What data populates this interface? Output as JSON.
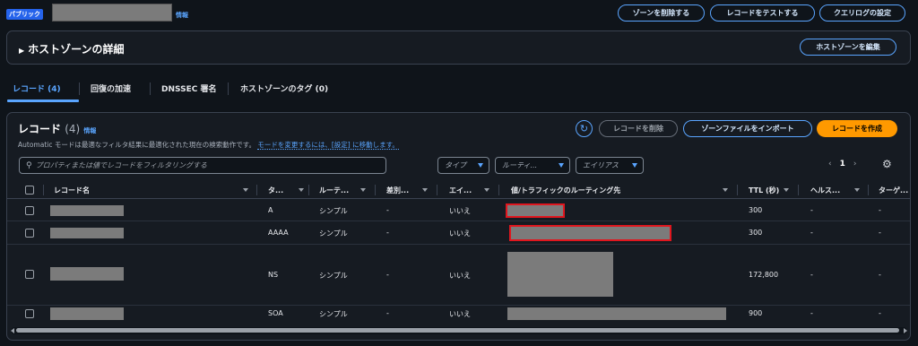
{
  "header": {
    "badge": "パブリック",
    "info": "情報",
    "buttons": {
      "delete_zone": "ゾーンを削除する",
      "test_record": "レコードをテストする",
      "query_log": "クエリログの設定"
    }
  },
  "hosted_zone_details": {
    "title": "ホストゾーンの詳細",
    "edit_button": "ホストゾーンを編集"
  },
  "tabs": [
    {
      "label": "レコード (4)"
    },
    {
      "label": "回復の加速"
    },
    {
      "label": "DNSSEC 署名"
    },
    {
      "label": "ホストゾーンのタグ (0)"
    }
  ],
  "records": {
    "title": "レコード",
    "count": "(4)",
    "info": "情報",
    "description": "Automatic モードは最適なフィルタ結果に最適化された現在の検索動作です。",
    "description_link": "モードを変更するには、[設定] に移動します。",
    "buttons": {
      "delete": "レコードを削除",
      "import": "ゾーンファイルをインポート",
      "create": "レコードを作成"
    },
    "search_placeholder": "プロパティまたは値でレコードをフィルタリングする",
    "filters": {
      "type": "タイプ",
      "routing": "ルーティ...",
      "alias": "エイリアス"
    },
    "page": "1",
    "columns": [
      "レコード名",
      "タ...",
      "ルーテ...",
      "差別...",
      "エイ...",
      "値/トラフィックのルーティング先",
      "TTL (秒)",
      "ヘルス...",
      "ターゲ..."
    ],
    "rows": [
      {
        "type": "A",
        "routing": "シンプル",
        "diff": "-",
        "alias": "いいえ",
        "ttl": "300",
        "health": "-",
        "target": "-"
      },
      {
        "type": "AAAA",
        "routing": "シンプル",
        "diff": "-",
        "alias": "いいえ",
        "ttl": "300",
        "health": "-",
        "target": "-"
      },
      {
        "type": "NS",
        "routing": "シンプル",
        "diff": "-",
        "alias": "いいえ",
        "ttl": "172,800",
        "health": "-",
        "target": "-"
      },
      {
        "type": "SOA",
        "routing": "シンプル",
        "diff": "-",
        "alias": "いいえ",
        "ttl": "900",
        "health": "-",
        "target": "-"
      }
    ]
  },
  "colors": {
    "accent": "#5aa5ff",
    "primary": "#ff9900",
    "highlight": "#e0161e",
    "background": "#0f141a"
  }
}
